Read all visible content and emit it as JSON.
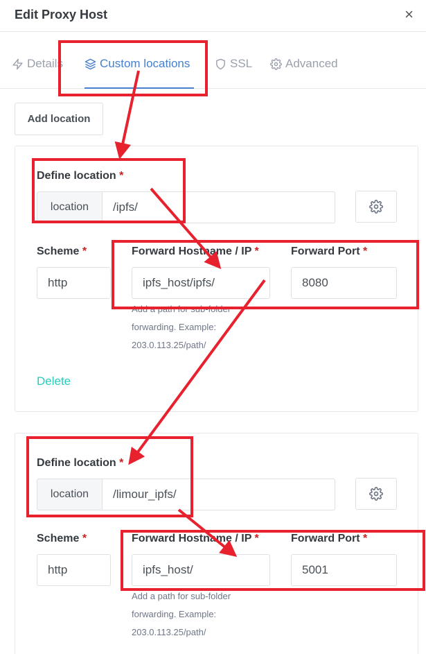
{
  "modal": {
    "title": "Edit Proxy Host",
    "close_symbol": "×"
  },
  "tabs": [
    {
      "label": "Details",
      "icon": "bolt-icon",
      "active": false
    },
    {
      "label": "Custom locations",
      "icon": "layers-icon",
      "active": true
    },
    {
      "label": "SSL",
      "icon": "shield-icon",
      "active": false
    },
    {
      "label": "Advanced",
      "icon": "gear-icon",
      "active": false
    }
  ],
  "add_location_label": "Add location",
  "required_mark": "*",
  "locations": [
    {
      "define_label": "Define location",
      "prefix": "location",
      "path": "/ipfs/",
      "scheme_label": "Scheme",
      "scheme": "http",
      "host_label": "Forward Hostname / IP",
      "host": "ipfs_host/ipfs/",
      "port_label": "Forward Port",
      "port": "8080",
      "help": "Add a path for sub-folder forwarding. Example: 203.0.113.25/path/",
      "delete_label": "Delete"
    },
    {
      "define_label": "Define location",
      "prefix": "location",
      "path": "/limour_ipfs/",
      "scheme_label": "Scheme",
      "scheme": "http",
      "host_label": "Forward Hostname / IP",
      "host": "ipfs_host/",
      "port_label": "Forward Port",
      "port": "5001",
      "help": "Add a path for sub-folder forwarding. Example: 203.0.113.25/path/"
    }
  ],
  "colors": {
    "accent": "#467fcf",
    "delete": "#2bcbba",
    "required": "#cd201f",
    "annotation_red": "#e8212e"
  }
}
